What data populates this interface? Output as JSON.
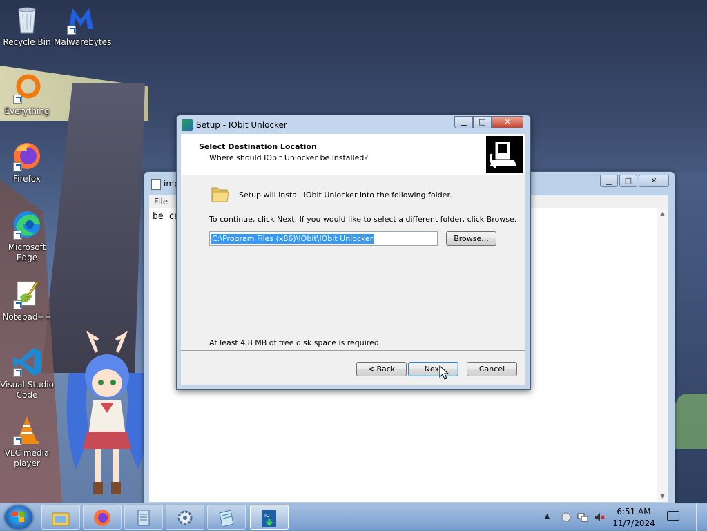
{
  "desktop": {
    "icons": [
      {
        "label": "Recycle Bin",
        "icon": "recycle-bin-icon"
      },
      {
        "label": "Malwarebytes",
        "icon": "malwarebytes-icon"
      },
      {
        "label": "Everything",
        "icon": "everything-search-icon"
      },
      {
        "label": "Firefox",
        "icon": "firefox-icon"
      },
      {
        "label": "Microsoft Edge",
        "icon": "edge-icon"
      },
      {
        "label": "Notepad++",
        "icon": "notepadpp-icon"
      },
      {
        "label": "Visual Studio Code",
        "icon": "vscode-icon"
      },
      {
        "label": "VLC media player",
        "icon": "vlc-icon"
      }
    ]
  },
  "notepad": {
    "title": "imp",
    "menu_file": "File",
    "text": "be ca"
  },
  "setup": {
    "title": "Setup - IObit Unlocker",
    "header_title": "Select Destination Location",
    "header_subtitle": "Where should IObit Unlocker be installed?",
    "install_line": "Setup will install IObit Unlocker into the following folder.",
    "continue_line": "To continue, click Next. If you would like to select a different folder, click Browse.",
    "path_value": "C:\\Program Files (x86)\\IObit\\IObit Unlocker",
    "browse_label": "Browse...",
    "disk_space_line": "At least 4.8 MB of free disk space is required.",
    "back_label": "< Back",
    "next_label": "Next",
    "cancel_label": "Cancel"
  },
  "taskbar": {
    "time": "6:51 AM",
    "date": "11/7/2024",
    "tray_arrow": "▲",
    "pinned": [
      "file-explorer-icon",
      "firefox-icon",
      "notepad-icon",
      "settings-icon",
      "notepad-document-icon",
      "iobit-setup-icon"
    ]
  },
  "colors": {
    "selection": "#3399ff",
    "titlebar": "#c4d6ee",
    "close_button": "#c6402a"
  }
}
